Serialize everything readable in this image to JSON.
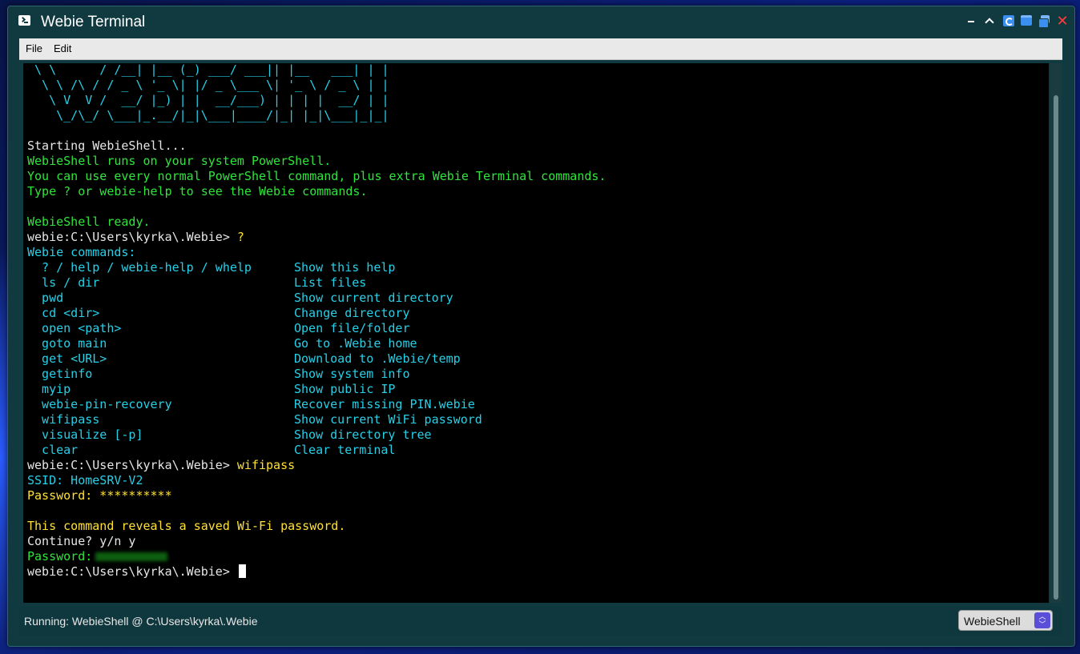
{
  "window": {
    "title": "Webie Terminal",
    "icons": [
      "terminal-icon",
      "minimize-icon",
      "collapse-icon",
      "refresh-icon",
      "window-icon",
      "restore-icon",
      "close-icon"
    ],
    "close_glyph": "✕"
  },
  "menu": {
    "file": "File",
    "edit": "Edit"
  },
  "terminal": {
    "banner": [
      " \\ \\      / /__| |__ (_) ___/ ___|| |__   ___| | |",
      "  \\ \\ /\\ / / _ \\ '_ \\| |/ _ \\___ \\| '_ \\ / _ \\ | |",
      "   \\ V  V /  __/ |_) | |  __/___) | | | |  __/ | |",
      "    \\_/\\_/ \\___|_.__/|_|\\___|____/|_| |_|\\___|_|_|"
    ],
    "starting": "Starting WebieShell...",
    "intro": [
      "WebieShell runs on your system PowerShell.",
      "You can use every normal PowerShell command, plus extra Webie Terminal commands.",
      "Type ? or webie-help to see the Webie commands."
    ],
    "ready": "WebieShell ready.",
    "prompt": "webie:C:\\Users\\kyrka\\.Webie> ",
    "first_command": "?",
    "help_header": "Webie commands:",
    "help_rows": [
      {
        "cmd": "  ? / help / webie-help / whelp",
        "desc": "Show this help"
      },
      {
        "cmd": "  ls / dir",
        "desc": "List files"
      },
      {
        "cmd": "  pwd",
        "desc": "Show current directory"
      },
      {
        "cmd": "  cd <dir>",
        "desc": "Change directory"
      },
      {
        "cmd": "  open <path>",
        "desc": "Open file/folder"
      },
      {
        "cmd": "  goto main",
        "desc": "Go to .Webie home"
      },
      {
        "cmd": "  get <URL>",
        "desc": "Download to .Webie/temp"
      },
      {
        "cmd": "  getinfo",
        "desc": "Show system info"
      },
      {
        "cmd": "  myip",
        "desc": "Show public IP"
      },
      {
        "cmd": "  webie-pin-recovery",
        "desc": "Recover missing PIN.webie"
      },
      {
        "cmd": "  wifipass",
        "desc": "Show current WiFi password"
      },
      {
        "cmd": "  visualize [-p]",
        "desc": "Show directory tree"
      },
      {
        "cmd": "  clear",
        "desc": "Clear terminal"
      }
    ],
    "second_command": "wifipass",
    "ssid": "SSID: HomeSRV-V2",
    "password_masked": "Password: **********",
    "warning": "This command reveals a saved Wi-Fi password.",
    "continue": "Continue? y/n y",
    "password_label": "Password:"
  },
  "status": {
    "text": "Running: WebieShell @ C:\\Users\\kyrka\\.Webie",
    "shell_selected": "WebieShell"
  }
}
